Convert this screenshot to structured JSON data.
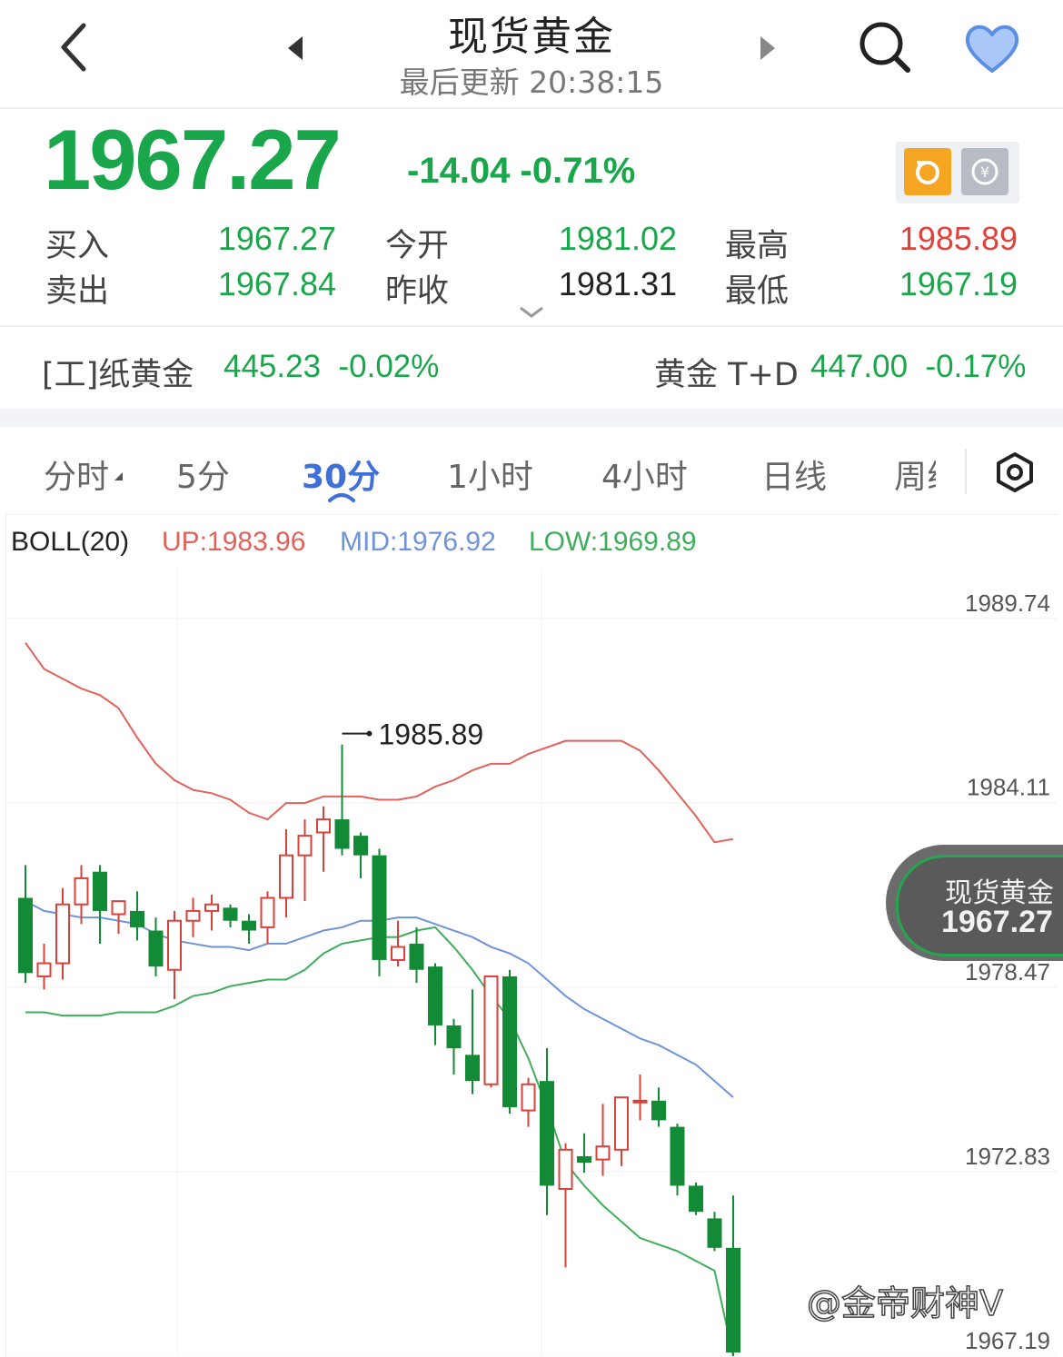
{
  "header": {
    "title": "现货黄金",
    "subtitle": "最后更新 20:38:15",
    "icons": [
      "back-icon",
      "prev-icon",
      "next-icon",
      "search-icon",
      "heart-icon"
    ]
  },
  "quote": {
    "price": "1967.27",
    "change": "-14.04 -0.71%",
    "rows": [
      {
        "l1": "买入",
        "v1": "1967.27",
        "l2": "今开",
        "v2": "1981.02",
        "l3": "最高",
        "v3": "1985.89"
      },
      {
        "l1": "卖出",
        "v1": "1967.84",
        "l2": "昨收",
        "v2": "1981.31",
        "l3": "最低",
        "v3": "1967.19"
      }
    ],
    "colors": {
      "down": "#1aa64a",
      "up": "#e0413a"
    }
  },
  "related": {
    "left_name": "[工]纸黄金",
    "left_value": "445.23  -0.02%",
    "right_name": "黄金 T+D",
    "right_value": "447.00  -0.17%"
  },
  "tabs": [
    "分时",
    "5分",
    "30分",
    "1小时",
    "4小时",
    "日线",
    "周线"
  ],
  "active_tab": "30分",
  "indicator": {
    "name": "BOLL(20)",
    "up": "UP:1983.96",
    "mid": "MID:1976.92",
    "low": "LOW:1969.89"
  },
  "tag": {
    "name": "现货黄金",
    "price": "1967.27"
  },
  "watermark": "@金帝财神V",
  "chart_data": {
    "type": "candlestick",
    "y_ticks": [
      "1989.74",
      "1984.11",
      "1978.47",
      "1972.83",
      "1967.19"
    ],
    "ylim": [
      1967.19,
      1989.74
    ],
    "high_marker": "1985.89",
    "candles": [
      {
        "o": 1981.2,
        "h": 1982.2,
        "l": 1978.6,
        "c": 1978.9
      },
      {
        "o": 1978.8,
        "h": 1979.8,
        "l": 1978.4,
        "c": 1979.2
      },
      {
        "o": 1979.2,
        "h": 1981.5,
        "l": 1978.7,
        "c": 1981.0
      },
      {
        "o": 1981.0,
        "h": 1982.2,
        "l": 1980.4,
        "c": 1981.8
      },
      {
        "o": 1982.0,
        "h": 1982.2,
        "l": 1979.8,
        "c": 1980.8
      },
      {
        "o": 1980.7,
        "h": 1981.0,
        "l": 1980.1,
        "c": 1981.1
      },
      {
        "o": 1980.8,
        "h": 1981.4,
        "l": 1979.9,
        "c": 1980.3
      },
      {
        "o": 1980.2,
        "h": 1980.6,
        "l": 1978.8,
        "c": 1979.1
      },
      {
        "o": 1979.0,
        "h": 1980.8,
        "l": 1978.1,
        "c": 1980.5
      },
      {
        "o": 1980.5,
        "h": 1981.2,
        "l": 1980.0,
        "c": 1980.8
      },
      {
        "o": 1980.8,
        "h": 1981.3,
        "l": 1980.2,
        "c": 1981.0
      },
      {
        "o": 1980.9,
        "h": 1981.0,
        "l": 1980.3,
        "c": 1980.5
      },
      {
        "o": 1980.5,
        "h": 1980.7,
        "l": 1979.8,
        "c": 1980.2
      },
      {
        "o": 1980.3,
        "h": 1981.4,
        "l": 1979.8,
        "c": 1981.2
      },
      {
        "o": 1981.2,
        "h": 1983.3,
        "l": 1980.6,
        "c": 1982.5
      },
      {
        "o": 1982.5,
        "h": 1983.6,
        "l": 1981.1,
        "c": 1983.1
      },
      {
        "o": 1983.2,
        "h": 1984.0,
        "l": 1982.0,
        "c": 1983.6
      },
      {
        "o": 1983.6,
        "h": 1985.89,
        "l": 1982.5,
        "c": 1982.7
      },
      {
        "o": 1983.1,
        "h": 1983.2,
        "l": 1981.8,
        "c": 1982.5
      },
      {
        "o": 1982.5,
        "h": 1982.7,
        "l": 1978.8,
        "c": 1979.3
      },
      {
        "o": 1979.3,
        "h": 1980.5,
        "l": 1979.1,
        "c": 1979.7
      },
      {
        "o": 1979.8,
        "h": 1980.3,
        "l": 1978.6,
        "c": 1979.0
      },
      {
        "o": 1979.1,
        "h": 1979.2,
        "l": 1976.7,
        "c": 1977.3
      },
      {
        "o": 1977.3,
        "h": 1977.5,
        "l": 1975.8,
        "c": 1976.6
      },
      {
        "o": 1976.4,
        "h": 1978.4,
        "l": 1975.2,
        "c": 1975.6
      },
      {
        "o": 1975.5,
        "h": 1978.8,
        "l": 1975.4,
        "c": 1978.8
      },
      {
        "o": 1978.8,
        "h": 1979.0,
        "l": 1974.6,
        "c": 1974.8
      },
      {
        "o": 1974.7,
        "h": 1975.7,
        "l": 1974.2,
        "c": 1975.5
      },
      {
        "o": 1975.6,
        "h": 1976.6,
        "l": 1971.5,
        "c": 1972.4
      },
      {
        "o": 1972.3,
        "h": 1973.7,
        "l": 1969.9,
        "c": 1973.5
      },
      {
        "o": 1973.3,
        "h": 1974.0,
        "l": 1972.8,
        "c": 1973.1
      },
      {
        "o": 1973.2,
        "h": 1974.9,
        "l": 1972.7,
        "c": 1973.6
      },
      {
        "o": 1973.5,
        "h": 1975.1,
        "l": 1973.0,
        "c": 1975.1
      },
      {
        "o": 1975.0,
        "h": 1975.8,
        "l": 1974.4,
        "c": 1975.0
      },
      {
        "o": 1975.0,
        "h": 1975.4,
        "l": 1974.2,
        "c": 1974.4
      },
      {
        "o": 1974.2,
        "h": 1974.3,
        "l": 1972.1,
        "c": 1972.4
      },
      {
        "o": 1972.4,
        "h": 1972.5,
        "l": 1971.5,
        "c": 1971.6
      },
      {
        "o": 1971.4,
        "h": 1971.6,
        "l": 1970.4,
        "c": 1970.5
      },
      {
        "o": 1970.5,
        "h": 1972.1,
        "l": 1967.19,
        "c": 1967.3
      }
    ],
    "boll_up": [
      1989.0,
      1988.2,
      1987.9,
      1987.6,
      1987.4,
      1987.0,
      1986.1,
      1985.3,
      1984.8,
      1984.5,
      1984.4,
      1984.2,
      1983.8,
      1983.6,
      1984.1,
      1984.1,
      1984.3,
      1984.3,
      1984.3,
      1984.2,
      1984.2,
      1984.3,
      1984.6,
      1984.8,
      1985.1,
      1985.3,
      1985.3,
      1985.6,
      1985.8,
      1986.0,
      1986.0,
      1986.0,
      1986.0,
      1985.7,
      1985.1,
      1984.4,
      1983.7,
      1982.9,
      1983.0
    ],
    "boll_mid": [
      1981.1,
      1980.8,
      1980.7,
      1980.6,
      1980.6,
      1980.5,
      1980.4,
      1980.1,
      1979.9,
      1979.8,
      1979.7,
      1979.7,
      1979.6,
      1979.8,
      1979.8,
      1980.0,
      1980.2,
      1980.3,
      1980.5,
      1980.5,
      1980.6,
      1980.6,
      1980.4,
      1980.2,
      1980.0,
      1979.7,
      1979.5,
      1979.2,
      1978.7,
      1978.2,
      1977.8,
      1977.5,
      1977.2,
      1976.9,
      1976.7,
      1976.4,
      1976.1,
      1975.6,
      1975.1
    ],
    "boll_low": [
      1977.7,
      1977.7,
      1977.6,
      1977.6,
      1977.6,
      1977.7,
      1977.7,
      1977.7,
      1977.9,
      1978.2,
      1978.3,
      1978.5,
      1978.6,
      1978.7,
      1978.7,
      1979.0,
      1979.5,
      1979.8,
      1979.9,
      1980.0,
      1980.0,
      1980.2,
      1980.3,
      1979.7,
      1979.0,
      1978.2,
      1977.5,
      1976.3,
      1974.8,
      1973.1,
      1972.4,
      1971.8,
      1971.3,
      1970.8,
      1970.6,
      1970.4,
      1970.1,
      1969.8,
      1967.2
    ]
  }
}
